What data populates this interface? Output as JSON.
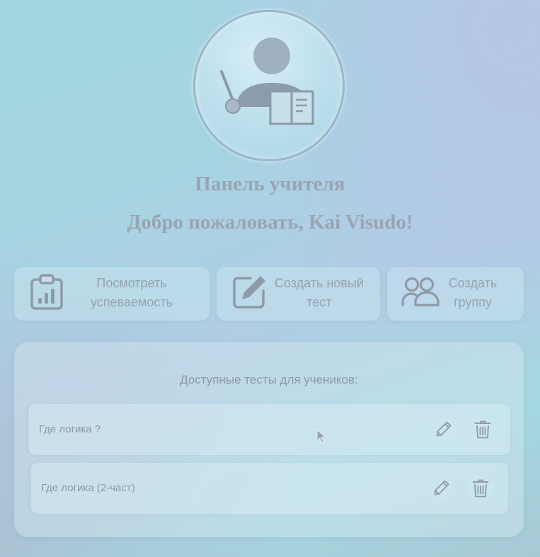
{
  "header": {
    "panel_title": "Панель учителя",
    "welcome_text": "Добро пожаловать, Kai Visudo!",
    "avatar_icon": "teacher-icon"
  },
  "actions": [
    {
      "label": "Посмотреть успеваемость",
      "icon": "clipboard-chart-icon"
    },
    {
      "label": "Создать новый тест",
      "icon": "edit-square-icon"
    },
    {
      "label": "Создать группу",
      "icon": "people-icon"
    }
  ],
  "tests": {
    "heading": "Доступные тесты для учеников:",
    "items": [
      {
        "name": "Где логика ?",
        "edit_icon": "pencil-icon",
        "delete_icon": "trash-icon"
      },
      {
        "name": "Где логика (2-част)",
        "edit_icon": "pencil-icon",
        "delete_icon": "trash-icon"
      }
    ]
  },
  "colors": {
    "text": "#9aa4b2",
    "icon": "#8f9aa8",
    "card_bg": "rgba(205,230,240,0.45)"
  }
}
